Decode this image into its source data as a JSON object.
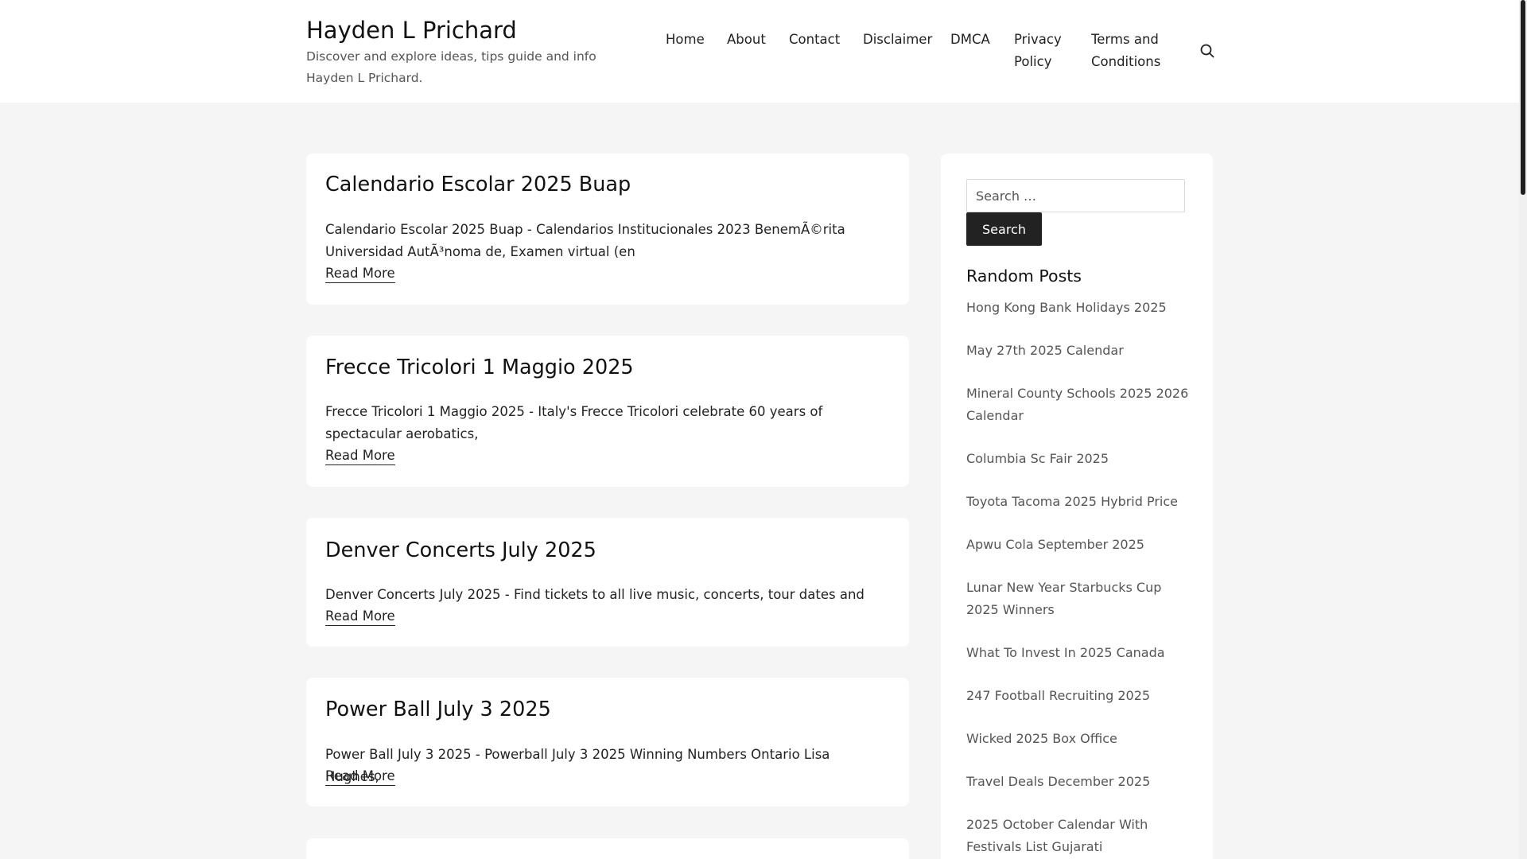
{
  "site": {
    "title": "Hayden L Prichard",
    "description": "Discover and explore ideas, tips guide and info Hayden L Prichard."
  },
  "nav": {
    "items": [
      "Home",
      "About",
      "Contact",
      "Disclaimer",
      "DMCA",
      "Privacy Policy",
      "Terms and Conditions"
    ],
    "search_icon": "search-icon"
  },
  "posts": [
    {
      "title": "Calendario Escolar 2025 Buap",
      "excerpt": "Calendario Escolar 2025 Buap - Calendarios Institucionales 2023 BenemÃ©rita Universidad AutÃ³noma de, Examen virtual (en",
      "read_more": "Read More"
    },
    {
      "title": "Frecce Tricolori 1 Maggio 2025",
      "excerpt": "Frecce Tricolori 1 Maggio 2025 - Italy's Frecce Tricolori celebrate 60 years of spectacular aerobatics,",
      "read_more": "Read More"
    },
    {
      "title": "Denver Concerts July 2025",
      "excerpt": "Denver Concerts July 2025 - Find tickets to all live music, concerts, tour dates and",
      "read_more": "Read More"
    },
    {
      "title": "Power Ball July 3 2025",
      "excerpt": "Power Ball July 3 2025 - Powerball July 3 2025 Winning Numbers Ontario Lisa Hughes,",
      "read_more": "Read More"
    }
  ],
  "sidebar": {
    "search_placeholder": "Search …",
    "search_button": "Search",
    "widget_title": "Random Posts",
    "random_posts": [
      "Hong Kong Bank Holidays 2025",
      "May 27th 2025 Calendar",
      "Mineral County Schools 2025 2026 Calendar",
      "Columbia Sc Fair 2025",
      "Toyota Tacoma 2025 Hybrid Price",
      "Apwu Cola September 2025",
      "Lunar New Year Starbucks Cup 2025 Winners",
      "What To Invest In 2025 Canada",
      "247 Football Recruiting 2025",
      "Wicked 2025 Box Office",
      "Travel Deals December 2025",
      "2025 October Calendar With Festivals List Gujarati"
    ]
  }
}
